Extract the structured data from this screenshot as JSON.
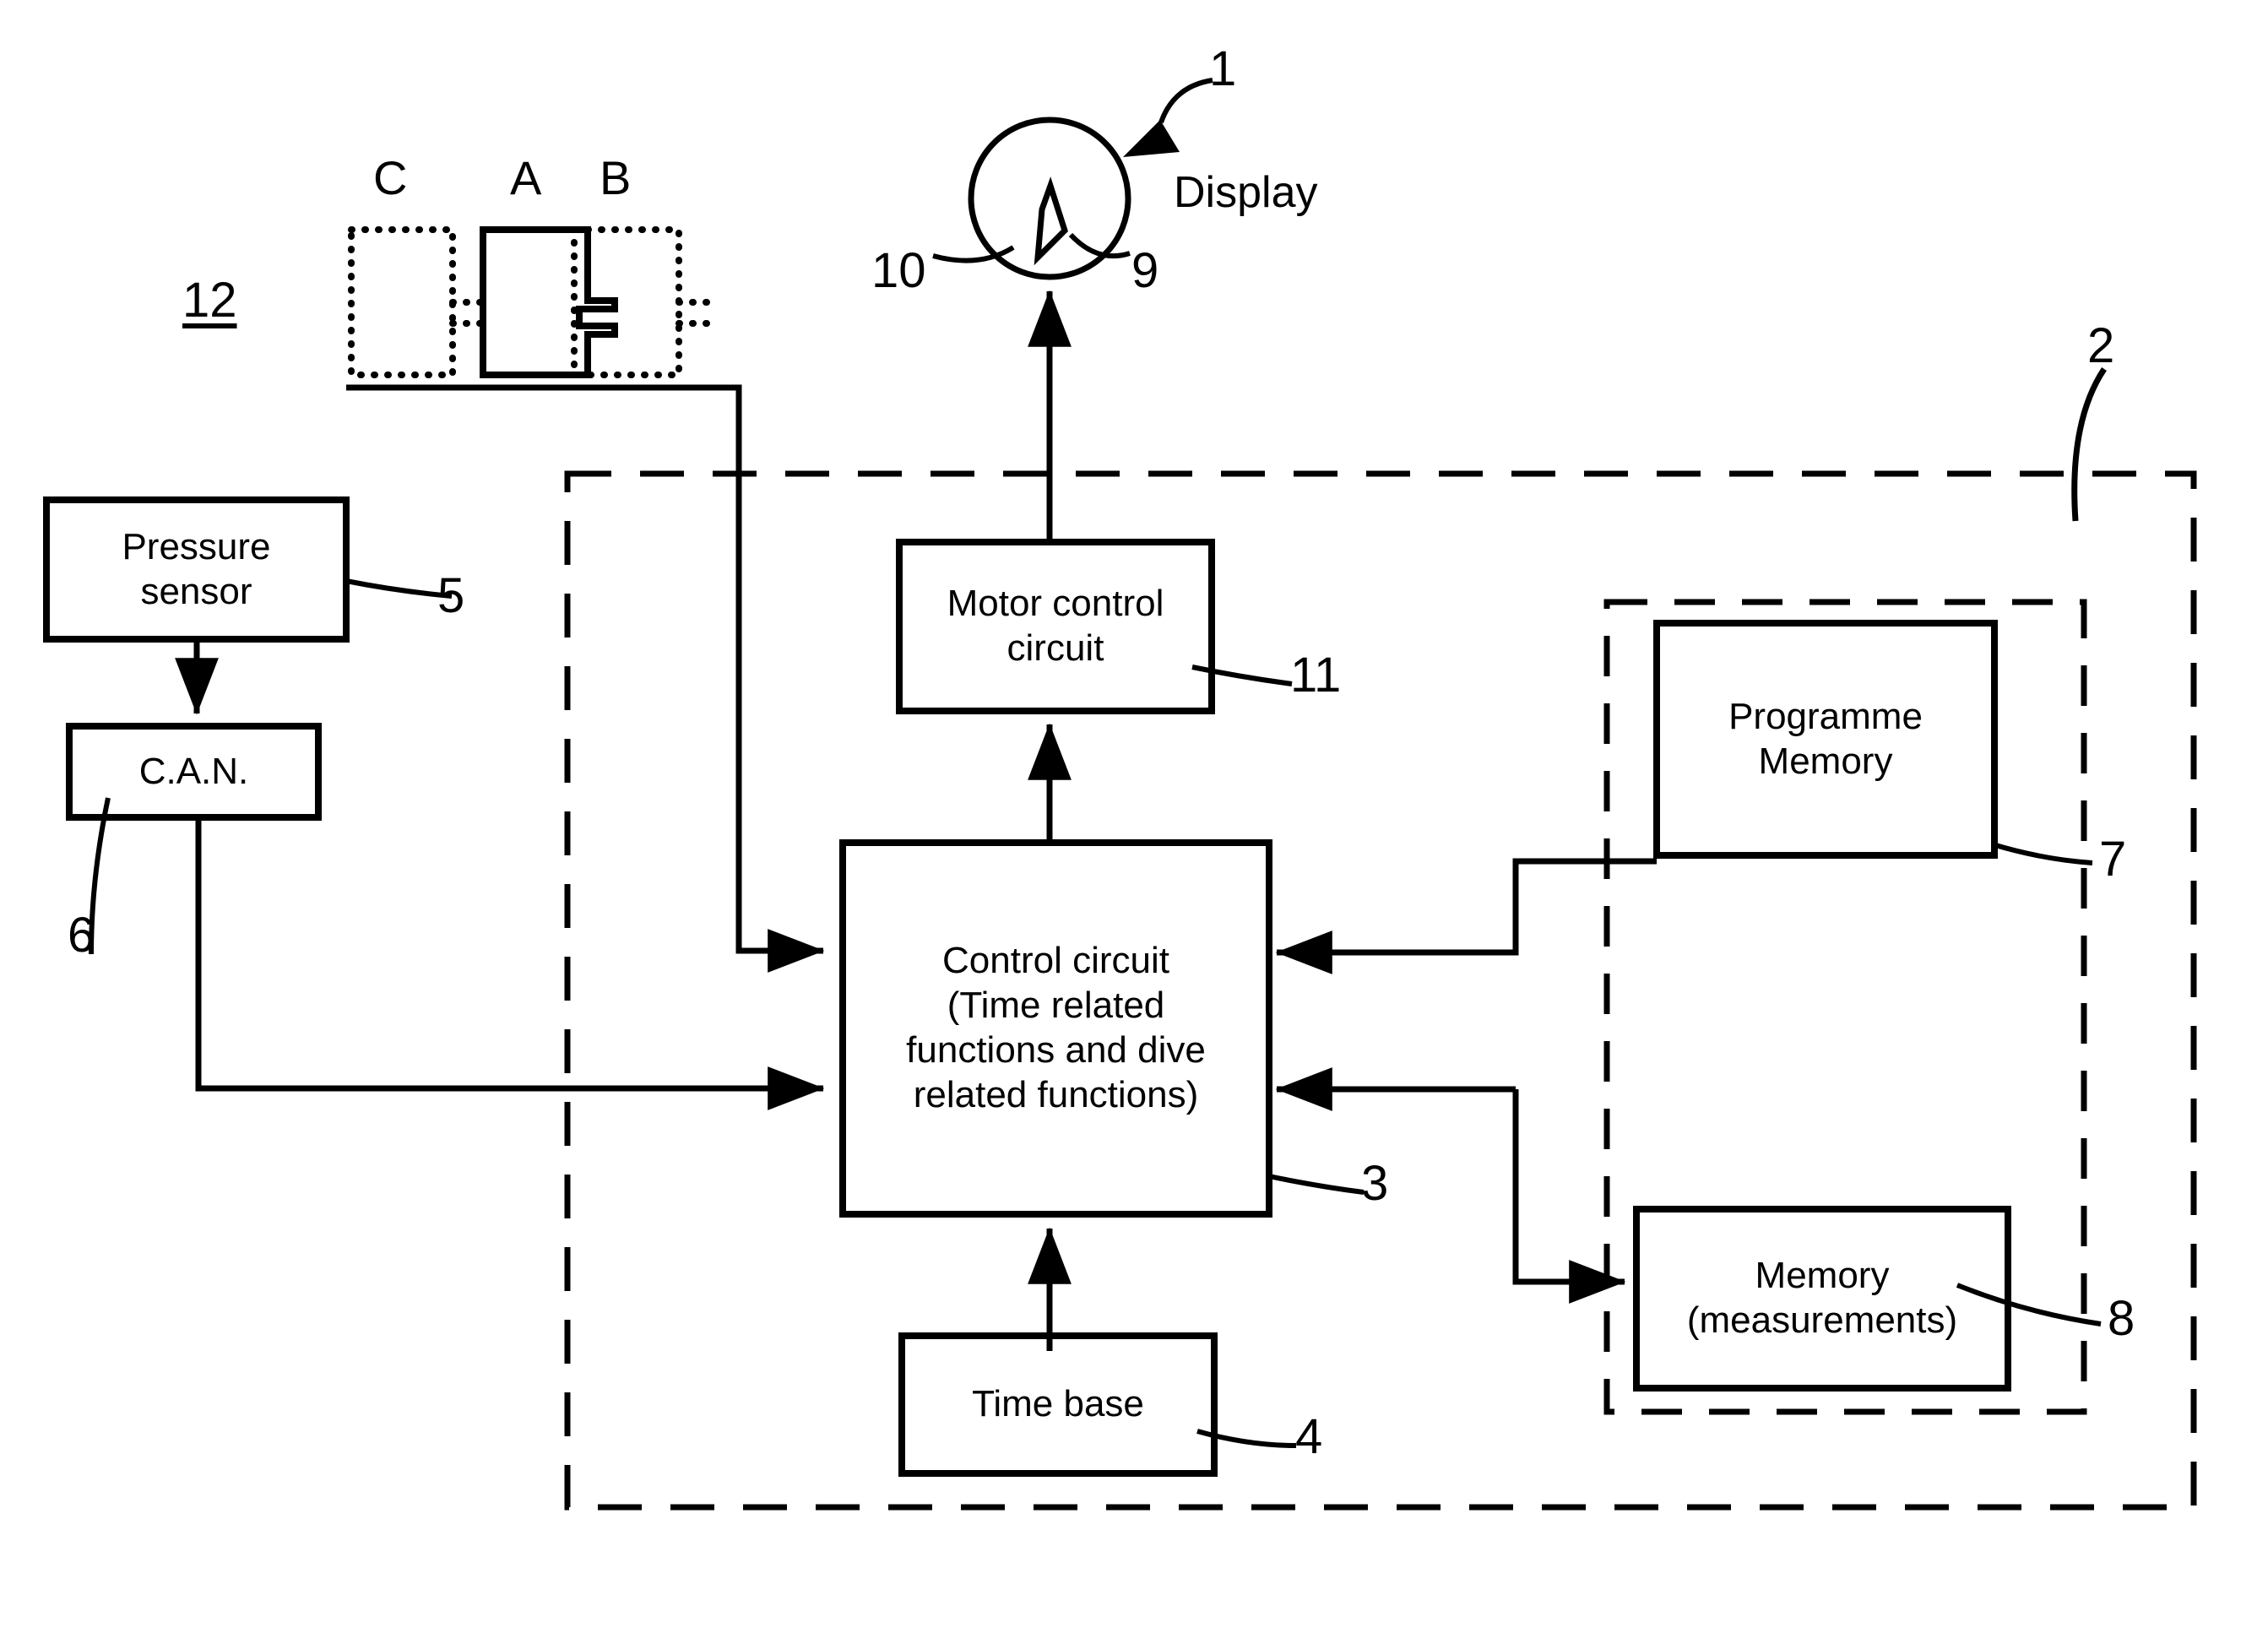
{
  "figure": {
    "title": "Dive computer block diagram",
    "stroke_color": "#000000",
    "background_color": "#ffffff"
  },
  "button_panel": {
    "ref": "12",
    "buttons": [
      {
        "label": "C",
        "style": "dotted"
      },
      {
        "label": "A",
        "style": "solid"
      },
      {
        "label": "B",
        "style": "dotted"
      }
    ]
  },
  "display": {
    "ref": "1",
    "label": "Display",
    "hand_ref": "9",
    "pivot_ref": "10"
  },
  "blocks": [
    {
      "id": "pressure_sensor",
      "label": "Pressure\nsensor",
      "ref": "5"
    },
    {
      "id": "can",
      "label": "C.A.N.",
      "ref": "6"
    },
    {
      "id": "motor_control",
      "label": "Motor control\ncircuit",
      "ref": "11"
    },
    {
      "id": "control_circuit",
      "label": "Control circuit\n(Time related\nfunctions and dive\nrelated functions)",
      "ref": "3"
    },
    {
      "id": "time_base",
      "label": "Time base",
      "ref": "4"
    },
    {
      "id": "programme_memory",
      "label": "Programme\nMemory",
      "ref": "7"
    },
    {
      "id": "memory_measurements",
      "label": "Memory\n(measurements)",
      "ref": "8"
    }
  ],
  "enclosures": [
    {
      "id": "outer_unit",
      "ref": "2",
      "style": "dashed"
    },
    {
      "id": "memory_group",
      "ref": "",
      "style": "dashed"
    }
  ],
  "refs": {
    "r1": "1",
    "r2": "2",
    "r3": "3",
    "r4": "4",
    "r5": "5",
    "r6": "6",
    "r7": "7",
    "r8": "8",
    "r9": "9",
    "r10": "10",
    "r11": "11",
    "r12": "12"
  }
}
